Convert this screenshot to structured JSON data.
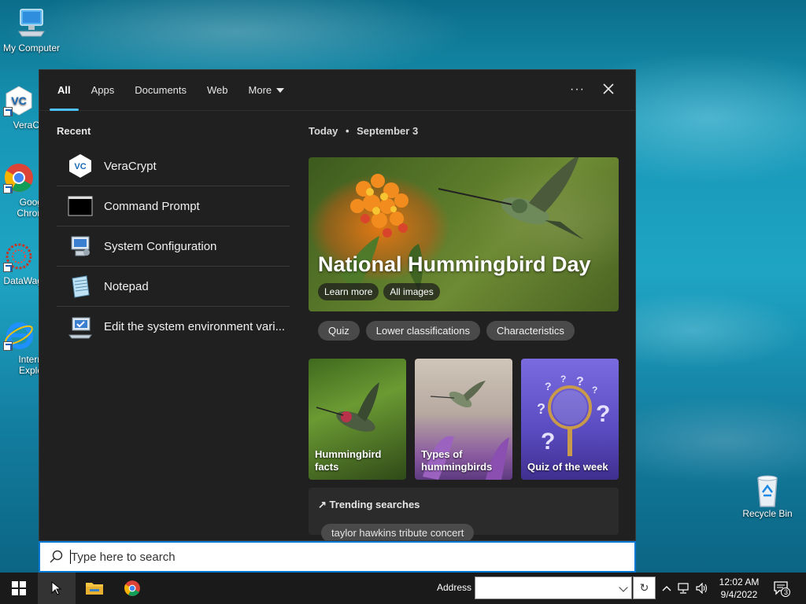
{
  "desktop": {
    "icons": [
      {
        "label": "My Computer"
      },
      {
        "label": "VeraCr"
      },
      {
        "label": "Goog\nChron"
      },
      {
        "label": "DataWag"
      },
      {
        "label": "Intern\nExplo"
      },
      {
        "label": "Recycle Bin"
      }
    ]
  },
  "search_panel": {
    "tabs": [
      "All",
      "Apps",
      "Documents",
      "Web",
      "More"
    ],
    "active_tab": "All",
    "recent": {
      "title": "Recent",
      "items": [
        {
          "label": "VeraCrypt",
          "icon": "veracrypt-icon"
        },
        {
          "label": "Command Prompt",
          "icon": "command-prompt-icon"
        },
        {
          "label": "System Configuration",
          "icon": "system-configuration-icon"
        },
        {
          "label": "Notepad",
          "icon": "notepad-icon"
        },
        {
          "label": "Edit the system environment vari...",
          "icon": "environment-variables-icon"
        }
      ]
    },
    "today": {
      "label": "Today",
      "separator": "•",
      "date": "September 3"
    },
    "hero": {
      "title": "National Hummingbird Day",
      "learn_more": "Learn more",
      "all_images": "All images"
    },
    "chips": [
      "Quiz",
      "Lower classifications",
      "Characteristics"
    ],
    "cards": [
      {
        "title": "Hummingbird facts"
      },
      {
        "title": "Types of hummingbirds"
      },
      {
        "title": "Quiz of the week"
      }
    ],
    "trending": {
      "title": "Trending searches",
      "first_item": "taylor hawkins tribute concert"
    }
  },
  "searchbox": {
    "placeholder": "Type here to search"
  },
  "taskbar": {
    "address_label": "Address",
    "address_value": "",
    "time": "12:02 AM",
    "date": "9/4/2022",
    "notification_count": "3"
  },
  "colors": {
    "accent": "#4cc2ff",
    "search_border": "#0078d4",
    "panel_bg": "#202020"
  }
}
